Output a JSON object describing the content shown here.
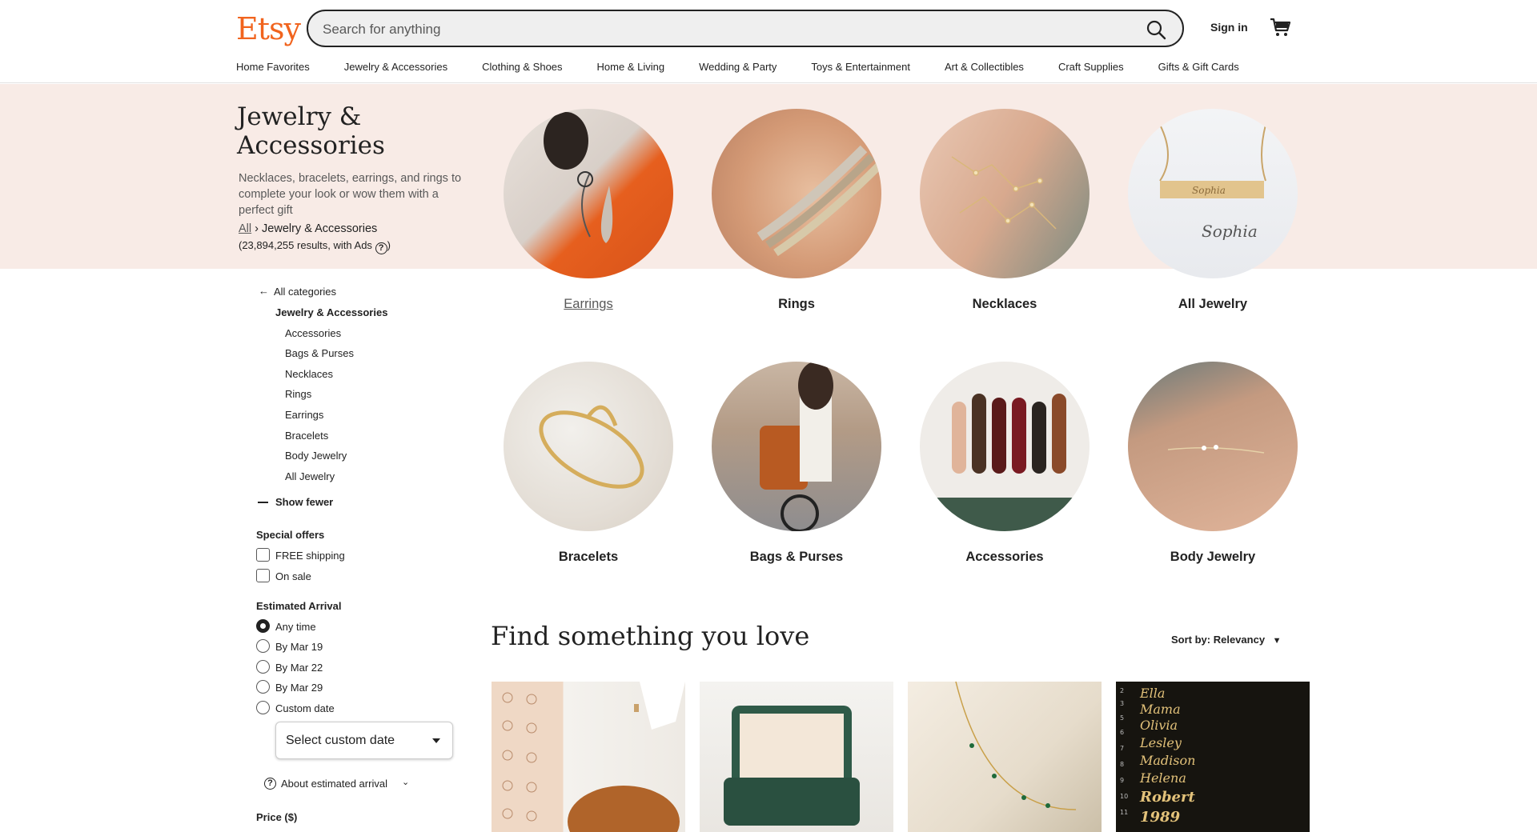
{
  "header": {
    "logo": "Etsy",
    "search_placeholder": "Search for anything",
    "sign_in": "Sign in"
  },
  "nav": [
    "Home Favorites",
    "Jewelry & Accessories",
    "Clothing & Shoes",
    "Home & Living",
    "Wedding & Party",
    "Toys & Entertainment",
    "Art & Collectibles",
    "Craft Supplies",
    "Gifts & Gift Cards"
  ],
  "hero": {
    "title_line1": "Jewelry &",
    "title_line2": "Accessories",
    "description": "Necklaces, bracelets, earrings, and rings to complete your look or wow them with a perfect gift",
    "breadcrumb_all": "All",
    "breadcrumb_current": "Jewelry & Accessories",
    "results": "(23,894,255 results, with Ads"
  },
  "categories": [
    {
      "label": "Earrings"
    },
    {
      "label": "Rings"
    },
    {
      "label": "Necklaces"
    },
    {
      "label": "All Jewelry"
    },
    {
      "label": "Bracelets"
    },
    {
      "label": "Bags & Purses"
    },
    {
      "label": "Accessories"
    },
    {
      "label": "Body Jewelry"
    }
  ],
  "sidebar": {
    "all_categories": "All categories",
    "current": "Jewelry & Accessories",
    "subcategories": [
      "Accessories",
      "Bags & Purses",
      "Necklaces",
      "Rings",
      "Earrings",
      "Bracelets",
      "Body Jewelry",
      "All Jewelry"
    ],
    "show_fewer": "Show fewer",
    "special_offers_title": "Special offers",
    "special_offers": [
      "FREE shipping",
      "On sale"
    ],
    "arrival_title": "Estimated Arrival",
    "arrival_options": [
      "Any time",
      "By Mar 19",
      "By Mar 22",
      "By Mar 29",
      "Custom date"
    ],
    "select_custom_date": "Select custom date",
    "about_arrival": "About estimated arrival",
    "price_title": "Price ($)"
  },
  "main": {
    "heading": "Find something you love",
    "sort_label": "Sort by: Relevancy"
  },
  "colors": {
    "brand": "#f1641e",
    "hero_bg": "#f8ebe6"
  }
}
